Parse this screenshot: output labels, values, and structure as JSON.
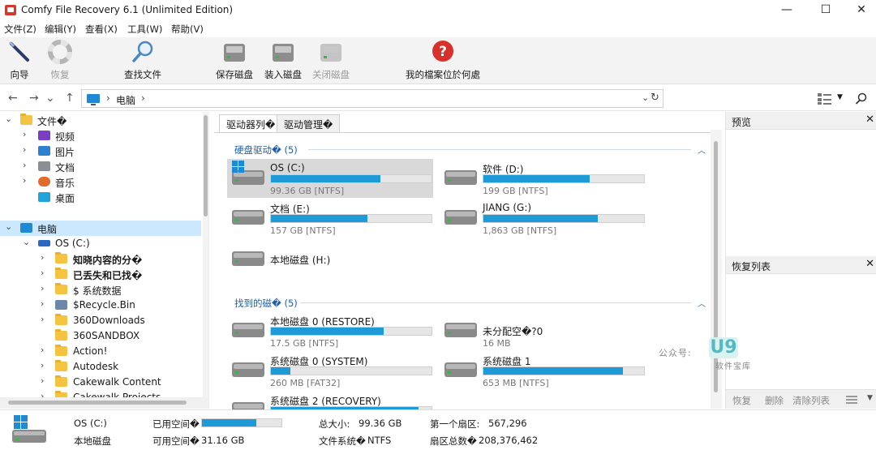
{
  "window": {
    "title": "Comfy File Recovery 6.1 (Unlimited Edition)",
    "controls": {
      "minimize": "—",
      "maximize": "☐",
      "close": "✕"
    }
  },
  "menu": [
    "文件(Z)",
    "编辑(Y)",
    "查看(X)",
    "工具(W)",
    "帮助(V)"
  ],
  "toolbar": {
    "wizard": "向导",
    "recover": "恢复",
    "find_files": "查找文件",
    "save_disk": "保存磁盘",
    "mount_disk": "装入磁盘",
    "close_disk": "关闭磁盘",
    "where_files": "我的檔案位於何處"
  },
  "address": {
    "crumb": "电脑",
    "back": "←",
    "forward": "→",
    "up": "↑",
    "separator": "›",
    "dropdown": "⌄",
    "refresh": "↻"
  },
  "tree": {
    "files_root": "文件�",
    "libraries": [
      "视频",
      "图片",
      "文档",
      "音乐",
      "桌面"
    ],
    "computer": "电脑",
    "os_drive": "OS (C:)",
    "os_children": [
      {
        "label": "知晓内容的分�",
        "bold": true
      },
      {
        "label": "已丢失和已找�",
        "bold": true
      },
      {
        "label": "$ 系统数据",
        "bold": false
      },
      {
        "label": "$Recycle.Bin",
        "bold": false
      },
      {
        "label": "360Downloads",
        "bold": false
      },
      {
        "label": "360SANDBOX",
        "bold": false
      },
      {
        "label": "Action!",
        "bold": false
      },
      {
        "label": "Autodesk",
        "bold": false
      },
      {
        "label": "Cakewalk Content",
        "bold": false
      },
      {
        "label": "Cakewalk Projects",
        "bold": false
      }
    ]
  },
  "tabs": {
    "drives": "驱动器列�",
    "drive_mgmt": "驱动管理�"
  },
  "hard_drives": {
    "title": "硬盘驱动�",
    "count": "(5)",
    "items": [
      {
        "name": "OS (C:)",
        "size": "99.36 GB [NTFS]",
        "used": 0.68
      },
      {
        "name": "软件 (D:)",
        "size": "199 GB [NTFS]",
        "used": 0.66
      },
      {
        "name": "文档 (E:)",
        "size": "157 GB [NTFS]",
        "used": 0.6
      },
      {
        "name": "JIANG (G:)",
        "size": "1,863 GB [NTFS]",
        "used": 0.71
      },
      {
        "name": "本地磁盘 (H:)"
      }
    ]
  },
  "found_drives": {
    "title": "找到的磁�",
    "count": "(5)",
    "items": [
      {
        "name": "本地磁盘 0 (RESTORE)",
        "size": "17.5 GB [NTFS]",
        "used": 0.7
      },
      {
        "name": "未分配空�?0",
        "size": "16 MB"
      },
      {
        "name": "系统磁盘 0 (SYSTEM)",
        "size": "260 MB [FAT32]",
        "used": 0.12
      },
      {
        "name": "系统磁盘 1",
        "size": "653 MB [NTFS]",
        "used": 0.87
      },
      {
        "name": "系统磁盘 2 (RECOVERY)",
        "size": "",
        "used": 0.92
      }
    ]
  },
  "preview": {
    "title": "预览",
    "close": "✕"
  },
  "recovery_list": {
    "title": "恢复列表",
    "close": "✕",
    "buttons": {
      "recover": "恢复",
      "delete": "删除",
      "clear": "清除列表"
    }
  },
  "watermark": {
    "prefix": "公众号:",
    "logo": "U9",
    "sub": "软件宝库"
  },
  "status": {
    "drive_name": "OS (C:)",
    "drive_type": "本地磁盘",
    "used_label": "已用空间�",
    "used_fraction": 0.68,
    "free_label": "可用空间�",
    "free_value": "31.16 GB",
    "total_label": "总大小:",
    "total_value": "99.36 GB",
    "fs_label": "文件系统�",
    "fs_value": "NTFS",
    "first_sector_label": "第一个扇区:",
    "first_sector_value": "567,296",
    "sector_count_label": "扇区总数�",
    "sector_count_value": "208,376,462"
  },
  "colors": {
    "accent": "#1e9ad6",
    "selection": "#cce8ff",
    "group_title": "#1f5fa8"
  }
}
